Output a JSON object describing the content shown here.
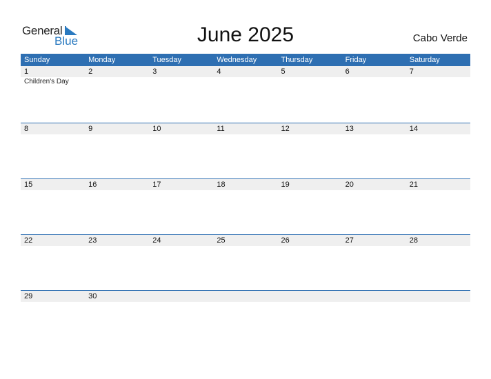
{
  "logo": {
    "general": "General",
    "blue": "Blue"
  },
  "title": "June 2025",
  "country": "Cabo Verde",
  "colors": {
    "accent": "#2e6fb2",
    "row_bg": "#efefef"
  },
  "weekdays": [
    "Sunday",
    "Monday",
    "Tuesday",
    "Wednesday",
    "Thursday",
    "Friday",
    "Saturday"
  ],
  "weeks": [
    {
      "days": [
        "1",
        "2",
        "3",
        "4",
        "5",
        "6",
        "7"
      ],
      "events": [
        "Children's Day",
        "",
        "",
        "",
        "",
        "",
        ""
      ]
    },
    {
      "days": [
        "8",
        "9",
        "10",
        "11",
        "12",
        "13",
        "14"
      ],
      "events": [
        "",
        "",
        "",
        "",
        "",
        "",
        ""
      ]
    },
    {
      "days": [
        "15",
        "16",
        "17",
        "18",
        "19",
        "20",
        "21"
      ],
      "events": [
        "",
        "",
        "",
        "",
        "",
        "",
        ""
      ]
    },
    {
      "days": [
        "22",
        "23",
        "24",
        "25",
        "26",
        "27",
        "28"
      ],
      "events": [
        "",
        "",
        "",
        "",
        "",
        "",
        ""
      ]
    },
    {
      "days": [
        "29",
        "30",
        "",
        "",
        "",
        "",
        ""
      ],
      "events": [
        "",
        "",
        "",
        "",
        "",
        "",
        ""
      ]
    }
  ]
}
